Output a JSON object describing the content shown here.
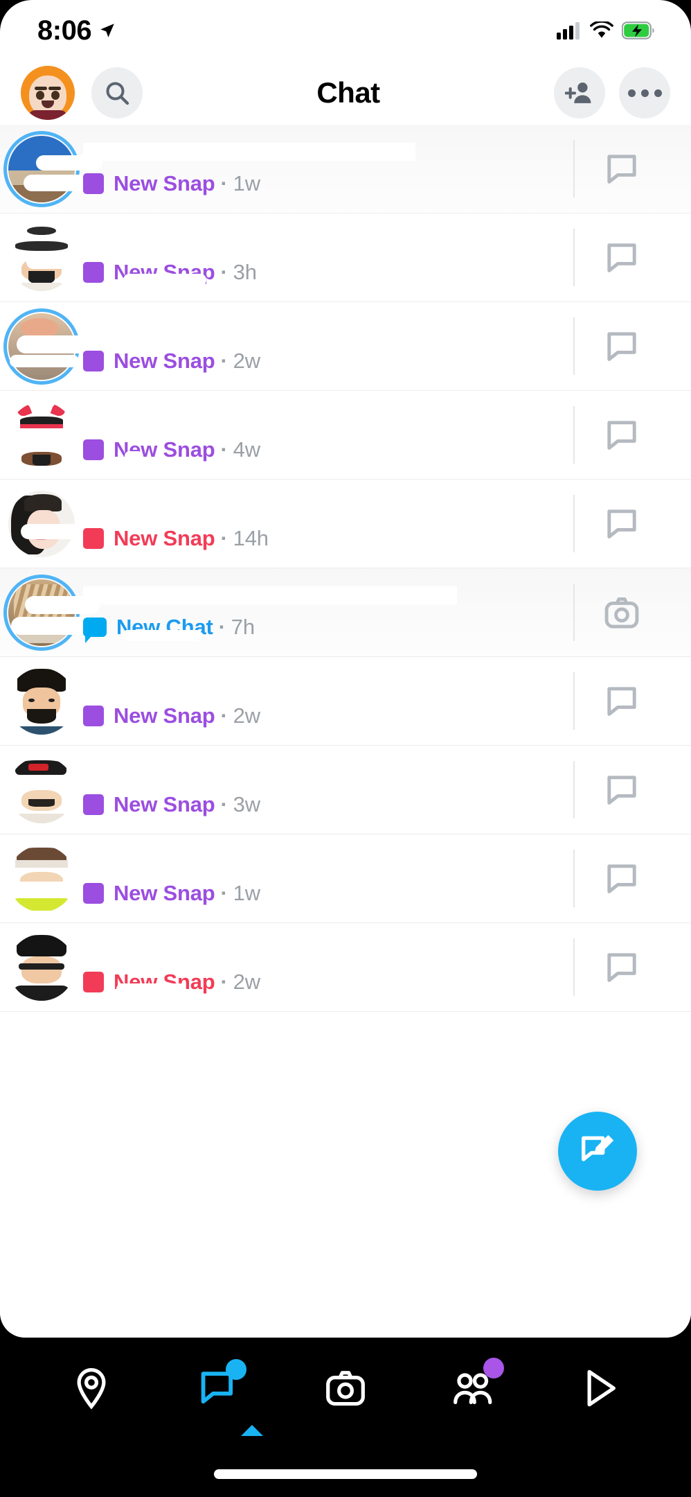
{
  "status_bar": {
    "time": "8:06",
    "location_icon": "location-arrow-icon",
    "cellular_icon": "cellular-signal-icon",
    "wifi_icon": "wifi-icon",
    "battery_icon": "battery-charging-icon",
    "battery_color": "#2ecc40"
  },
  "header": {
    "title": "Chat",
    "avatar_icon": "bitmoji-avatar",
    "search_icon": "search-icon",
    "add_friend_icon": "add-friend-icon",
    "more_icon": "more-options-icon"
  },
  "colors": {
    "snap_purple": "#9b4ee0",
    "snap_red": "#f23c57",
    "chat_blue": "#1b9bf0",
    "story_ring": "#4fb4f5",
    "fab_blue": "#19b3f3",
    "muted_text": "#9aa0a6"
  },
  "chats": [
    {
      "name_redacted": true,
      "state": "New Snap",
      "state_color": "purple",
      "time": "1w",
      "status_icon": "snap-square-icon",
      "action_icon": "chat-bubble-icon",
      "has_story_ring": true,
      "row_tinted": true,
      "avatar_kind": "photo-landscape"
    },
    {
      "name_redacted": true,
      "state": "New Snap",
      "state_color": "purple",
      "time": "3h",
      "status_icon": "snap-square-icon",
      "action_icon": "chat-bubble-icon",
      "has_story_ring": false,
      "row_tinted": false,
      "avatar_kind": "bitmoji-beard"
    },
    {
      "name_redacted": true,
      "state": "New Snap",
      "state_color": "purple",
      "time": "2w",
      "status_icon": "snap-square-icon",
      "action_icon": "chat-bubble-icon",
      "has_story_ring": true,
      "row_tinted": false,
      "avatar_kind": "photo-hand"
    },
    {
      "name_redacted": true,
      "state": "New Snap",
      "state_color": "purple",
      "time": "4w",
      "status_icon": "snap-square-icon",
      "action_icon": "chat-bubble-icon",
      "has_story_ring": false,
      "row_tinted": false,
      "avatar_kind": "bitmoji-hearts"
    },
    {
      "name_redacted": true,
      "state": "New Snap",
      "state_color": "red",
      "time": "14h",
      "status_icon": "snap-square-icon",
      "action_icon": "chat-bubble-icon",
      "has_story_ring": false,
      "row_tinted": false,
      "avatar_kind": "bitmoji-dark-hair"
    },
    {
      "name_redacted": true,
      "state": "New Chat",
      "state_color": "blue",
      "time": "7h",
      "status_icon": "chat-bubble-filled-icon",
      "action_icon": "camera-icon",
      "has_story_ring": true,
      "row_tinted": true,
      "avatar_kind": "photo-cat"
    },
    {
      "name_redacted": true,
      "state": "New Snap",
      "state_color": "purple",
      "time": "2w",
      "status_icon": "snap-square-icon",
      "action_icon": "chat-bubble-icon",
      "has_story_ring": false,
      "row_tinted": false,
      "avatar_kind": "bitmoji-black-hair"
    },
    {
      "name_redacted": true,
      "state": "New Snap",
      "state_color": "purple",
      "time": "3w",
      "status_icon": "snap-square-icon",
      "action_icon": "chat-bubble-icon",
      "has_story_ring": false,
      "row_tinted": false,
      "avatar_kind": "bitmoji-cap-100"
    },
    {
      "name_redacted": true,
      "state": "New Snap",
      "state_color": "purple",
      "time": "1w",
      "status_icon": "snap-square-icon",
      "action_icon": "chat-bubble-icon",
      "has_story_ring": false,
      "row_tinted": false,
      "avatar_kind": "bitmoji-headband"
    },
    {
      "name_redacted": true,
      "state": "New Snap",
      "state_color": "red",
      "time": "2w",
      "status_icon": "snap-square-icon",
      "action_icon": "chat-bubble-icon",
      "has_story_ring": false,
      "row_tinted": false,
      "avatar_kind": "bitmoji-glasses"
    }
  ],
  "fab": {
    "icon": "compose-chat-icon",
    "label": "New Chat"
  },
  "bottom_nav": {
    "items": [
      {
        "icon": "map-pin-icon",
        "active": false,
        "badge": null
      },
      {
        "icon": "chat-icon",
        "active": true,
        "badge": "blue"
      },
      {
        "icon": "camera-icon",
        "active": false,
        "badge": null
      },
      {
        "icon": "friends-icon",
        "active": false,
        "badge": "purple"
      },
      {
        "icon": "spotlight-play-icon",
        "active": false,
        "badge": null
      }
    ],
    "active_index": 1
  }
}
